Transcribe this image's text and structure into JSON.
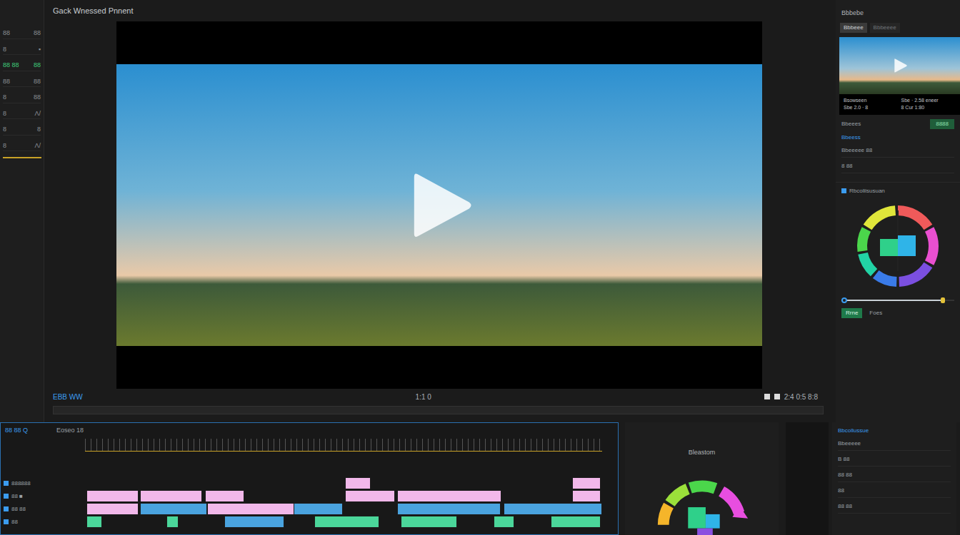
{
  "window": {
    "title": "Gack Wnessed Pnnent"
  },
  "left_panel": {
    "rows": [
      {
        "label": "88",
        "value": "88",
        "accent": false
      },
      {
        "label": "8",
        "value": "▪",
        "accent": false
      },
      {
        "label": "88 88",
        "value": "88",
        "accent": true
      },
      {
        "label": "88",
        "value": "88",
        "accent": false
      },
      {
        "label": "8",
        "value": "88",
        "accent": false
      },
      {
        "label": "8",
        "value": "Λ/",
        "accent": false
      },
      {
        "label": "8",
        "value": "8",
        "accent": false
      },
      {
        "label": "8",
        "value": "Λ/",
        "accent": false
      }
    ]
  },
  "viewer": {
    "timecode": "EBB WW",
    "center_readout": "1:1 0",
    "right_readout": "2:4 0:5 8:8",
    "play": "▶"
  },
  "right_panel": {
    "header": "Bbbebe",
    "tabs": [
      {
        "label": "Bbbeee",
        "selected": true
      },
      {
        "label": "Bbbeeee",
        "selected": false
      }
    ],
    "thumbnail_caption": [
      "Bsowseen",
      "Sbe · 2.58 eneer",
      "Sbe 2.0 · 8",
      "8 Cur 1:80"
    ],
    "info_label": "Bbeees",
    "info_button": "8888",
    "section_title": "Bbeess",
    "section_rows": [
      "Bbeeeee 88",
      "8 88"
    ],
    "color_title": "Rbcoliisusuan",
    "slider": {
      "level": 0.9
    },
    "color_button": "Rrne",
    "color_note": "Foes",
    "bottom_title": "Bbcollussue",
    "bottom_rows": [
      "Bbeeeee",
      "B 88",
      "88 88",
      "88",
      "88 88"
    ]
  },
  "timeline": {
    "header": "88 88 Q",
    "header_mid": "Eoseo 18",
    "tracks": [
      {
        "label": "888888",
        "clips": [
          {
            "start": 50.3,
            "length": 4.9,
            "color": "#f2b8ea"
          },
          {
            "start": 94.2,
            "length": 5.5,
            "color": "#f2b8ea"
          }
        ]
      },
      {
        "label": "88 ■",
        "clips": [
          {
            "start": 0.3,
            "length": 10,
            "color": "#f2b8ea"
          },
          {
            "start": 10.7,
            "length": 12,
            "color": "#f2b8ea"
          },
          {
            "start": 23.2,
            "length": 7.6,
            "color": "#f2b8ea"
          },
          {
            "start": 50.3,
            "length": 9.7,
            "color": "#f2b8ea"
          },
          {
            "start": 60.4,
            "length": 20.1,
            "color": "#f2b8ea"
          },
          {
            "start": 94.2,
            "length": 5.5,
            "color": "#f2b8ea"
          }
        ]
      },
      {
        "label": "88 88",
        "clips": [
          {
            "start": 0.3,
            "length": 10,
            "color": "#f2b8ea"
          },
          {
            "start": 10.6,
            "length": 13,
            "color": "#4aa3df"
          },
          {
            "start": 23.6,
            "length": 17,
            "color": "#f2b8ea"
          },
          {
            "start": 40.3,
            "length": 9.5,
            "color": "#4aa3df"
          },
          {
            "start": 60.4,
            "length": 20,
            "color": "#4aa3df"
          },
          {
            "start": 81,
            "length": 19,
            "color": "#4aa3df"
          }
        ]
      },
      {
        "label": "88",
        "clips": [
          {
            "start": 0.3,
            "length": 3,
            "color": "#4bd69a"
          },
          {
            "start": 15.7,
            "length": 2.4,
            "color": "#4bd69a"
          },
          {
            "start": 27,
            "length": 11.5,
            "color": "#4aa3df"
          },
          {
            "start": 44.4,
            "length": 12.5,
            "color": "#4bd69a"
          },
          {
            "start": 61,
            "length": 11,
            "color": "#4bd69a"
          },
          {
            "start": 79,
            "length": 4,
            "color": "#4bd69a"
          },
          {
            "start": 90,
            "length": 9.7,
            "color": "#4bd69a"
          }
        ]
      }
    ]
  },
  "color_panel": {
    "title": "Bleastom"
  }
}
